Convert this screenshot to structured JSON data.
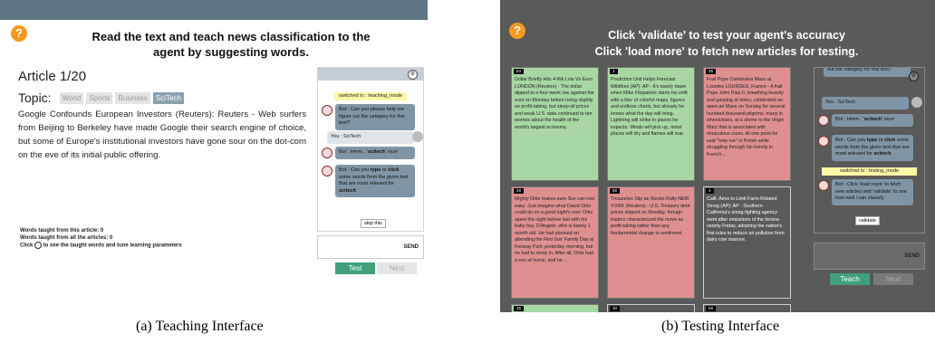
{
  "teaching": {
    "header": {
      "line1": "Read the text and teach news classification to the",
      "line2": "agent by suggesting words."
    },
    "article_counter": "Article 1/20",
    "topic_label": "Topic:",
    "topics": [
      "World",
      "Sports",
      "Business",
      "SciTech"
    ],
    "selected_topic": "SciTech",
    "article_text": "Google Confounds European Investors (Reuters): Reuters - Web surfers from Beijing to Berkeley have made Google their search engine of choice, but some of Europe's institutional investors have gone sour on the dot-com on the eve of its initial public offering.",
    "stats": {
      "words_article": "Words taught from this article: 0",
      "words_all": "Words taught from all the articles: 0",
      "click_pre": "Click",
      "click_post": "to see the taught words and tune learning parameters"
    },
    "chat": {
      "system_switch": "switched to : teaching_mode",
      "bot1": "Bot : Can you please help me figure out the category for this text?",
      "user1": "You : SciTech",
      "bot2_pre": "Bot : Hmm..",
      "bot2_word": "'scitech'",
      "bot2_post": ".nice!",
      "bot3_pre": "Bot : Can you",
      "bot3_type": "type",
      "bot3_or": "or",
      "bot3_click": "click",
      "bot3_mid": "some words from the given text that are most relevant for",
      "bot3_topic": "scitech",
      "skip": "skip this",
      "send": "SEND"
    },
    "buttons": {
      "test": "Test",
      "next": "Next"
    },
    "caption": "(a) Teaching Interface"
  },
  "testing": {
    "header": {
      "line1": "Click 'validate' to test your agent's accuracy",
      "line2": "Click 'load more' to fetch new articles for testing."
    },
    "cards": [
      {
        "num": "54",
        "text": "Dollar Briefly Hits 4-Wk Low Vs Euro LONDON (Reuters) - The dollar dipped to a four-week low against the euro on Monday before rising slightly on profit-taking, but steep oil prices and weak U.S. data continued to fan worries about the health of the world's largest economy."
      },
      {
        "num": "3",
        "text": "Prediction Unit Helps Forecast Wildfires (AP): AP - It's barely dawn when Mike Fitzpatrick starts his shift with a blur of colorful maps, figures and endless charts, but already he knows what the day will bring. Lightning will strike in places he expects. Winds will pick up, moist places will dry and flames will roar."
      },
      {
        "num": "35",
        "text": "Frail Pope Celebrates Mass at Lourdes LOURDES, France - A frail Pope John Paul II, breathing heavily and gasping at times, celebrated an open-air Mass on Sunday for several hundred thousand pilgrims, many in wheelchairs, at a shrine to the Virgin Mary that is associated with miraculous cures. At one point he said \"help me\" in Polish while struggling through his homily in French..."
      },
      {
        "num": "29",
        "text": "Mighty Ortiz makes sure Sox can rest easy: Just imagine what David Ortiz could do on a good night's rest. Ortiz spent the night before last with his baby boy, D'Angelo, who is barely 1 month old. He had planned on attending the Red Sox' Family Day at Fenway Park yesterday morning, but he had to sleep in. After all, Ortiz had a son at home, and he ..."
      },
      {
        "num": "55",
        "text": "Treasuries Slip as Stocks Rally NEW YORK (Reuters) - U.S. Treasury debt prices slipped on Monday, though traders characterized the move as profit-taking rather than any fundamental change in sentiment."
      },
      {
        "num": "4",
        "text": "Calif. Aims to Limit Farm-Related Smog (AP): AP - Southern California's smog-fighting agency went after emissions of the bovine variety Friday, adopting the nation's first rules to reduce air pollution from dairy cow manure."
      },
      {
        "num": "36",
        "text": ""
      },
      {
        "num": "30",
        "text": ""
      },
      {
        "num": "59",
        "text": ""
      }
    ],
    "chat": {
      "cut_top": "out the category for this text?",
      "user": "You : SciTech",
      "bot1_pre": "Bot : Hmm..",
      "bot1_word": "'scitech'",
      "bot1_post": ".nice!",
      "bot2_pre": "Bot : Can you",
      "bot2_type": "type",
      "bot2_or": "or",
      "bot2_click": "click",
      "bot2_mid": "some words from the given text that are most relevant for",
      "bot2_topic": "scitech",
      "system_switch": "switched to : testing_mode",
      "bot3": "Bot : Click 'load more' to fetch new articles and 'validate' to see how well i can classify",
      "validate": "validate",
      "send": "SEND"
    },
    "buttons": {
      "teach": "Teach",
      "next": "Next"
    },
    "caption": "(b) Testing Interface"
  },
  "colors": {
    "help": "#f39a1f",
    "topbar": "#5f7585",
    "bubble": "#7f95a5",
    "green_card": "#a8d7a3",
    "red_card": "#de9090",
    "button_green": "#3fa07a",
    "switch_bg": "#fdf7a6"
  }
}
